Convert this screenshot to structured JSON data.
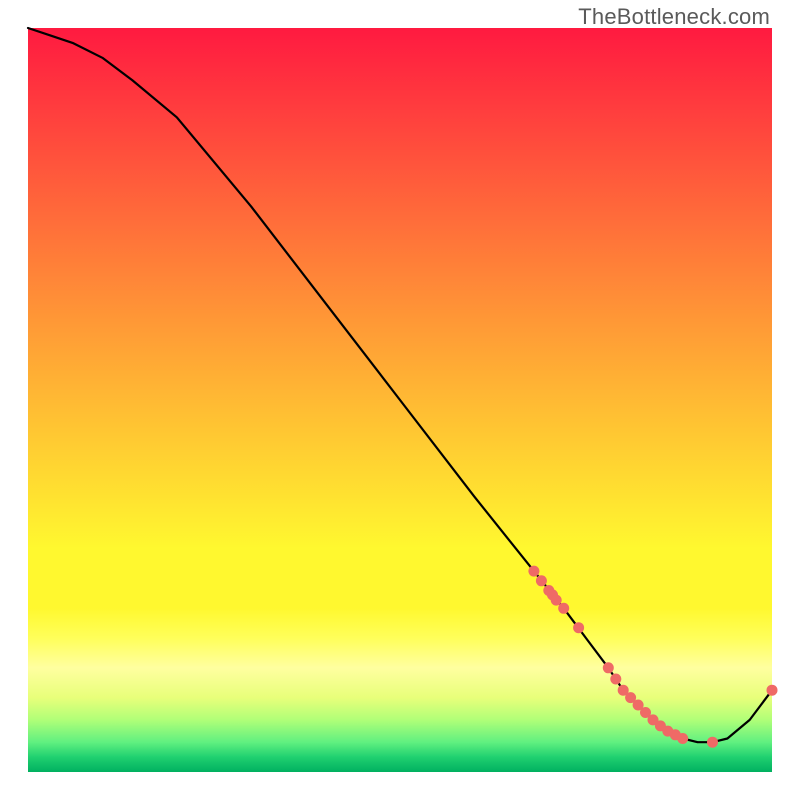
{
  "watermark": "TheBottleneck.com",
  "chart_data": {
    "type": "line",
    "title": "",
    "xlabel": "",
    "ylabel": "",
    "xlim": [
      0,
      100
    ],
    "ylim": [
      0,
      100
    ],
    "grid": false,
    "legend": false,
    "series": [
      {
        "name": "bottleneck-curve",
        "color": "#000000",
        "x": [
          0,
          3,
          6,
          10,
          14,
          20,
          30,
          40,
          50,
          60,
          68,
          72,
          75,
          78,
          80,
          82,
          84,
          86,
          88,
          90,
          92,
          94,
          97,
          100
        ],
        "y": [
          100,
          99,
          98,
          96,
          93,
          88,
          76,
          63,
          50,
          37,
          27,
          22,
          18,
          14,
          11,
          9,
          7,
          5.5,
          4.5,
          4,
          4,
          4.5,
          7,
          11
        ]
      },
      {
        "name": "bottleneck-points",
        "type": "scatter",
        "color": "#ef6a66",
        "x": [
          68,
          69,
          70,
          70.5,
          71,
          72,
          74,
          78,
          79,
          80,
          81,
          82,
          83,
          84,
          85,
          86,
          87,
          88,
          92,
          100
        ],
        "y": [
          27,
          25.7,
          24.4,
          23.8,
          23.1,
          22,
          19.4,
          14,
          12.5,
          11,
          10,
          9,
          8,
          7,
          6.2,
          5.5,
          5,
          4.5,
          4,
          11
        ]
      }
    ]
  }
}
